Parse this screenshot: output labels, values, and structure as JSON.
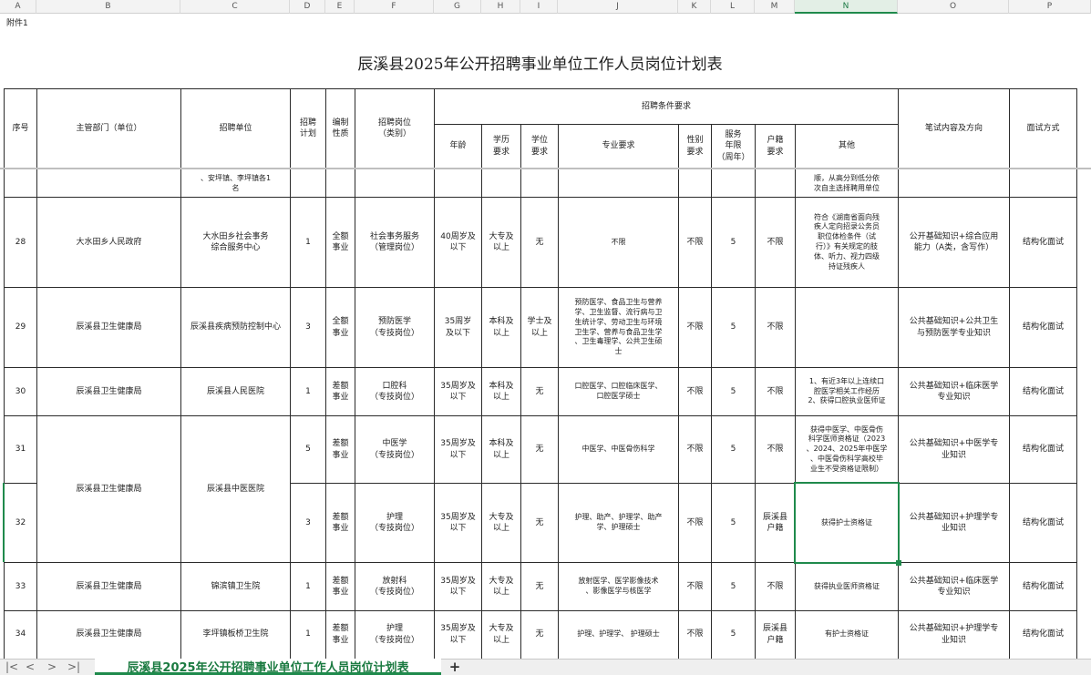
{
  "column_headers": [
    "A",
    "B",
    "C",
    "D",
    "E",
    "F",
    "G",
    "H",
    "I",
    "J",
    "K",
    "L",
    "M",
    "N",
    "O",
    "P"
  ],
  "attachment_label": "附件1",
  "title": "辰溪县2025年公开招聘事业单位工作人员岗位计划表",
  "header": {
    "seq": "序号",
    "dept": "主管部门（单位）",
    "unit": "招聘单位",
    "plan": "招聘\n计划",
    "nature": "编制\n性质",
    "post": "招聘岗位\n（类别）",
    "conditions": "招聘条件要求",
    "age": "年龄",
    "edu": "学历\n要求",
    "degree": "学位\n要求",
    "major": "专业要求",
    "gender": "性别\n要求",
    "service": "服务\n年限\n（周年）",
    "hukou": "户籍\n要求",
    "other": "其他",
    "exam": "笔试内容及方向",
    "interview": "面试方式"
  },
  "partial_row": {
    "unit": "、安坪镇、李坪镇各1\n名",
    "other": "顺，从高分到低分依\n次自主选择聘用单位"
  },
  "rows": [
    {
      "seq": "28",
      "dept": "大水田乡人民政府",
      "unit": "大水田乡社会事务\n综合服务中心",
      "plan": "1",
      "nature": "全额\n事业",
      "post": "社会事务服务\n（管理岗位）",
      "age": "40周岁及\n以下",
      "edu": "大专及\n以上",
      "degree": "无",
      "major": "不限",
      "gender": "不限",
      "service": "5",
      "hukou": "不限",
      "other": "符合《湖南省面向残\n疾人定向招录公务员\n职位体检条件（试\n行）》有关规定的肢\n体、听力、视力四级\n持证残疾人",
      "exam": "公开基础知识+综合应用\n能力（A类，含写作）",
      "interview": "结构化面试"
    },
    {
      "seq": "29",
      "dept": "辰溪县卫生健康局",
      "unit": "辰溪县疾病预防控制中心",
      "plan": "3",
      "nature": "全额\n事业",
      "post": "预防医学\n（专技岗位）",
      "age": "35周岁\n及以下",
      "edu": "本科及\n以上",
      "degree": "学士及\n以上",
      "major": "预防医学、食品卫生与营养\n学、卫生监督、流行病与卫\n生统计学、劳动卫生与环境\n卫生学、营养与食品卫生学\n、卫生毒理学、公共卫生硕\n士",
      "gender": "不限",
      "service": "5",
      "hukou": "不限",
      "other": "",
      "exam": "公共基础知识+公共卫生\n与预防医学专业知识",
      "interview": "结构化面试"
    },
    {
      "seq": "30",
      "dept": "辰溪县卫生健康局",
      "unit": "辰溪县人民医院",
      "plan": "1",
      "nature": "差额\n事业",
      "post": "口腔科\n（专技岗位）",
      "age": "35周岁及\n以下",
      "edu": "本科及\n以上",
      "degree": "无",
      "major": "口腔医学、口腔临床医学、\n口腔医学硕士",
      "gender": "不限",
      "service": "5",
      "hukou": "不限",
      "other": "1、有近3年以上连续口\n腔医学相关工作经历\n2、获得口腔执业医师证",
      "exam": "公共基础知识+临床医学\n专业知识",
      "interview": "结构化面试"
    },
    {
      "seq": "31",
      "dept": "",
      "unit": "",
      "plan": "5",
      "nature": "差额\n事业",
      "post": "中医学\n（专技岗位）",
      "age": "35周岁及\n以下",
      "edu": "本科及\n以上",
      "degree": "无",
      "major": "中医学、中医骨伤科学",
      "gender": "不限",
      "service": "5",
      "hukou": "不限",
      "other": "获得中医学、中医骨伤\n科学医师资格证（2023\n、2024、2025年中医学\n、中医骨伤科学高校毕\n业生不受资格证限制）",
      "exam": "公共基础知识+中医学专\n业知识",
      "interview": "结构化面试"
    },
    {
      "seq": "32",
      "dept": "",
      "unit": "",
      "plan": "3",
      "nature": "差额\n事业",
      "post": "护理\n（专技岗位）",
      "age": "35周岁及\n以下",
      "edu": "大专及\n以上",
      "degree": "无",
      "major": "护理、助产、护理学、助产\n学、护理硕士",
      "gender": "不限",
      "service": "5",
      "hukou": "辰溪县\n户籍",
      "other": "获得护士资格证",
      "exam": "公共基础知识+护理学专\n业知识",
      "interview": "结构化面试"
    },
    {
      "seq": "33",
      "dept": "辰溪县卫生健康局",
      "unit": "锦滨镇卫生院",
      "plan": "1",
      "nature": "差额\n事业",
      "post": "放射科\n（专技岗位）",
      "age": "35周岁及\n以下",
      "edu": "大专及\n以上",
      "degree": "无",
      "major": "放射医学、医学影像技术\n、影像医学与核医学",
      "gender": "不限",
      "service": "5",
      "hukou": "不限",
      "other": "获得执业医师资格证",
      "exam": "公共基础知识+临床医学\n专业知识",
      "interview": "结构化面试"
    },
    {
      "seq": "34",
      "dept": "辰溪县卫生健康局",
      "unit": "李坪镇板桥卫生院",
      "plan": "1",
      "nature": "差额\n事业",
      "post": "护理\n（专技岗位）",
      "age": "35周岁及\n以下",
      "edu": "大专及\n以上",
      "degree": "无",
      "major": "护理、护理学、  护理硕士",
      "gender": "不限",
      "service": "5",
      "hukou": "辰溪县\n户籍",
      "other": "有护士资格证",
      "exam": "公共基础知识+护理学专\n业知识",
      "interview": "结构化面试"
    }
  ],
  "merged_31_32": {
    "dept": "辰溪县卫生健康局",
    "unit": "辰溪县中医医院"
  },
  "sheet_tab": "辰溪县2025年公开招聘事业单位工作人员岗位计划表",
  "nav": {
    "first": "|<",
    "prev": "<",
    "next": ">",
    "last": ">|",
    "add": "+"
  },
  "colors": {
    "accent": "#1f8a4c",
    "grid": "#2b2b2b",
    "header_bg": "#f3f3f3"
  }
}
